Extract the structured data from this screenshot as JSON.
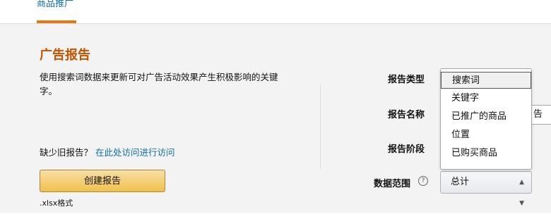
{
  "tabs": {
    "active_label": "商品推广"
  },
  "section": {
    "title": "广告报告",
    "description": "使用搜索词数据来更新可对广告活动效果产生积极影响的关键字。",
    "missing_prefix": "缺少旧报告？",
    "missing_link": "在此处访问进行访问",
    "create_button": "创建报告",
    "format_note": ".xlsx格式"
  },
  "form": {
    "report_type_label": "报告类型",
    "report_name_label": "报告名称",
    "report_stage_label": "报告阶段",
    "data_range_label": "数据范围",
    "help_icon": "question-circle-icon",
    "report_name_value_visible": "告",
    "data_range_value": "总计"
  },
  "dropdown": {
    "selected_index": 0,
    "options": [
      "搜索词",
      "关键字",
      "已推广的商品",
      "位置",
      "已购买商品"
    ]
  },
  "colors": {
    "accent_orange": "#e47911",
    "title_orange": "#c45500",
    "link_blue": "#0f6fa8",
    "button_yellow": "#f0c14b"
  }
}
